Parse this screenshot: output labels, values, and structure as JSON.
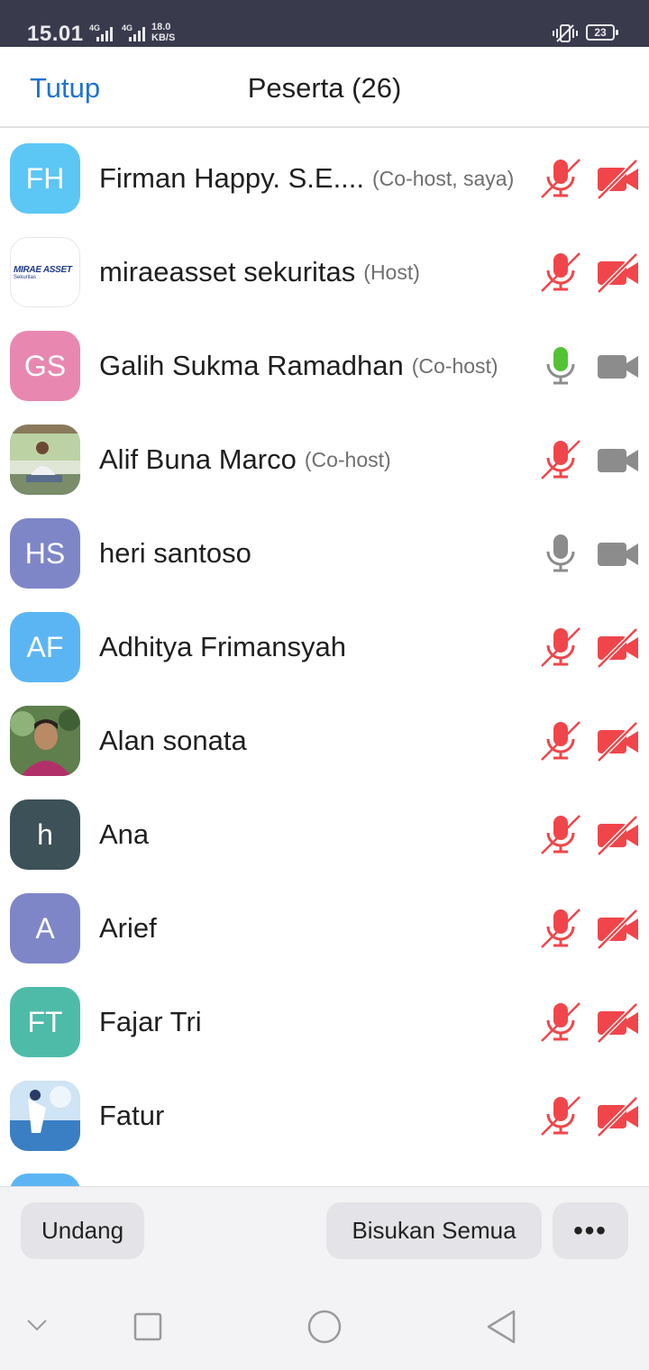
{
  "status_bar": {
    "time": "15.01",
    "signal1_label": "4G",
    "signal2_label": "4G",
    "speed_value": "18.0",
    "speed_unit": "KB/S",
    "battery": "23",
    "vibrate_icon": "vibrate-icon"
  },
  "header": {
    "close_label": "Tutup",
    "title": "Peserta (26)"
  },
  "colors": {
    "accent": "#1c73d4",
    "muted_red": "#f0464b",
    "mic_active_green": "#55c235",
    "icon_gray": "#8c8c8c"
  },
  "participants": [
    {
      "initials": "FH",
      "name": "Firman Happy. S.E....",
      "role": "(Co-host, saya)",
      "mic": "muted",
      "video": "off"
    },
    {
      "initials": "MIRAE ASSET",
      "logo_sub": "Sekuritas",
      "name": "miraeasset sekuritas",
      "role": "(Host)",
      "mic": "muted",
      "video": "off"
    },
    {
      "initials": "GS",
      "name": "Galih Sukma Ramadhan",
      "role": "(Co-host)",
      "mic": "speaking",
      "video": "on"
    },
    {
      "initials": "",
      "name": "Alif Buna Marco",
      "role": "(Co-host)",
      "mic": "muted",
      "video": "on"
    },
    {
      "initials": "HS",
      "name": "heri santoso",
      "role": "",
      "mic": "unmuted",
      "video": "on"
    },
    {
      "initials": "AF",
      "name": "Adhitya Frimansyah",
      "role": "",
      "mic": "muted",
      "video": "off"
    },
    {
      "initials": "",
      "name": "Alan sonata",
      "role": "",
      "mic": "muted",
      "video": "off"
    },
    {
      "initials": "h",
      "name": "Ana",
      "role": "",
      "mic": "muted",
      "video": "off"
    },
    {
      "initials": "A",
      "name": "Arief",
      "role": "",
      "mic": "muted",
      "video": "off"
    },
    {
      "initials": "FT",
      "name": "Fajar Tri",
      "role": "",
      "mic": "muted",
      "video": "off"
    },
    {
      "initials": "",
      "name": "Fatur",
      "role": "",
      "mic": "muted",
      "video": "off"
    }
  ],
  "footer": {
    "invite_label": "Undang",
    "mute_all_label": "Bisukan Semua",
    "more_label": "•••"
  },
  "system_nav": {
    "icons": [
      "chevron-down-icon",
      "recents-square-icon",
      "home-circle-icon",
      "back-triangle-icon"
    ]
  }
}
